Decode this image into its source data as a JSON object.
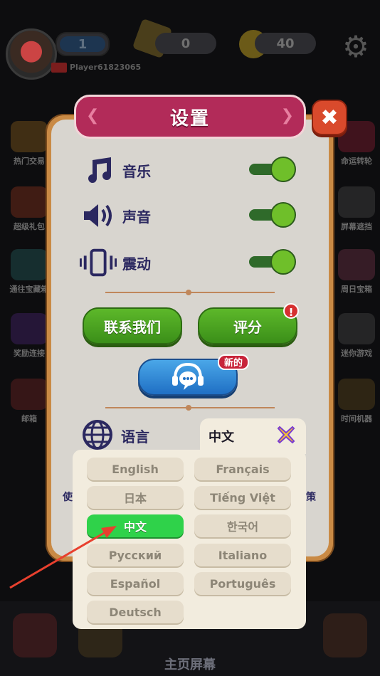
{
  "hud": {
    "level": "1",
    "gems": "0",
    "coins": "40",
    "player_name": "Player61823065"
  },
  "side_left": [
    "热门交易",
    "超级礼包",
    "通往宝藏箱",
    "奖励连接",
    "邮箱"
  ],
  "side_right": [
    "命运转轮",
    "屏幕遮挡",
    "周日宝箱",
    "迷你游戏",
    "时间机器"
  ],
  "bottom": {
    "label": "主页屏幕"
  },
  "settings": {
    "title": "设置",
    "close_glyph": "✖",
    "rows": [
      {
        "label": "音乐",
        "icon": "music-note-icon",
        "on": true
      },
      {
        "label": "声音",
        "icon": "speaker-icon",
        "on": true
      },
      {
        "label": "震动",
        "icon": "vibration-icon",
        "on": true
      }
    ],
    "contact_label": "联系我们",
    "rate_label": "评分",
    "rate_badge": "!",
    "support_badge": "新的",
    "language_label": "语言",
    "left_note": "使",
    "right_note": "策"
  },
  "language_popup": {
    "current": "中文",
    "options": [
      {
        "label": "English",
        "selected": false
      },
      {
        "label": "Français",
        "selected": false
      },
      {
        "label": "日本",
        "selected": false
      },
      {
        "label": "Tiếng Việt",
        "selected": false
      },
      {
        "label": "中文",
        "selected": true
      },
      {
        "label": "한국어",
        "selected": false
      },
      {
        "label": "Русский",
        "selected": false
      },
      {
        "label": "Italiano",
        "selected": false
      },
      {
        "label": "Español",
        "selected": false
      },
      {
        "label": "Português",
        "selected": false
      },
      {
        "label": "Deutsch",
        "selected": false
      }
    ]
  },
  "colors": {
    "accent_green": "#2fd24a",
    "title_pink": "#b22b59",
    "arrow_red": "#e8402e"
  }
}
